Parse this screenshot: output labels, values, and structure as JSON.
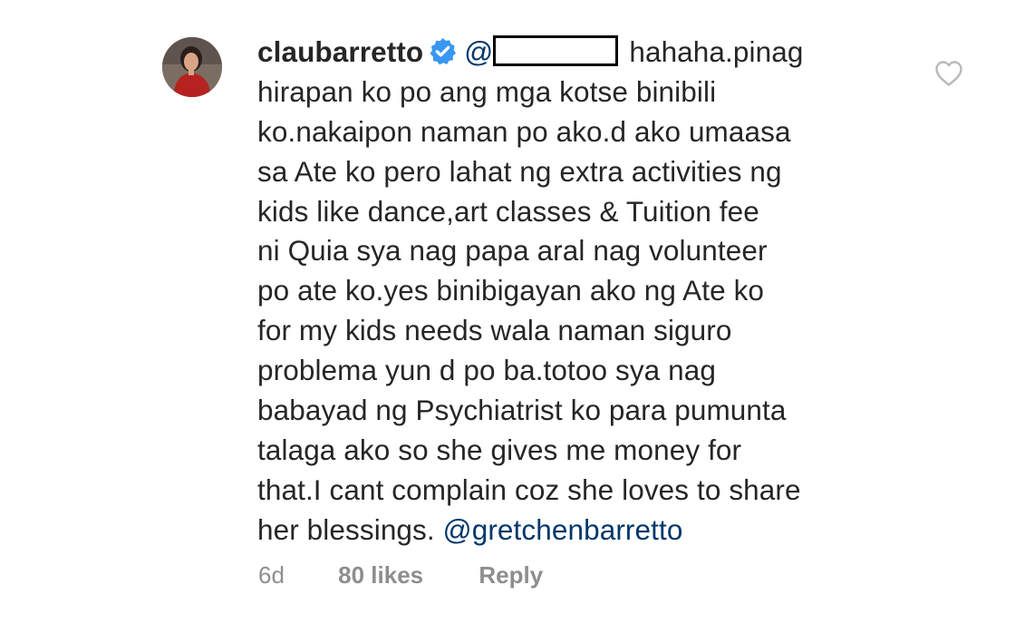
{
  "comment": {
    "username": "claubarretto",
    "verified": true,
    "mention_prefix": "@",
    "first_line_rest": "hahaha.pinag",
    "lines": [
      "hirapan ko po ang mga kotse binibili",
      "ko.nakaipon naman po ako.d ako umaasa",
      "sa Ate ko pero lahat ng extra activities ng",
      "kids like dance,art classes & Tuition fee",
      "ni Quia sya nag papa aral nag volunteer",
      "po ate ko.yes binibigayan ako ng Ate ko",
      "for my kids needs wala naman siguro",
      "problema yun d po ba.totoo sya nag",
      "babayad ng Psychiatrist ko para pumunta",
      "talaga ako so she gives me money for",
      "that.I cant complain coz she loves to share"
    ],
    "last_line_text": "her blessings.",
    "last_line_mention": "@gretchenbarretto",
    "time": "6d",
    "likes": "80 likes",
    "reply_label": "Reply"
  },
  "icons": {
    "avatar": "profile-avatar",
    "verified": "verified-badge-icon",
    "like": "heart-outline-icon"
  },
  "colors": {
    "text": "#262626",
    "mention": "#00376b",
    "meta": "#8e8e8e",
    "verified": "#3897f0"
  }
}
